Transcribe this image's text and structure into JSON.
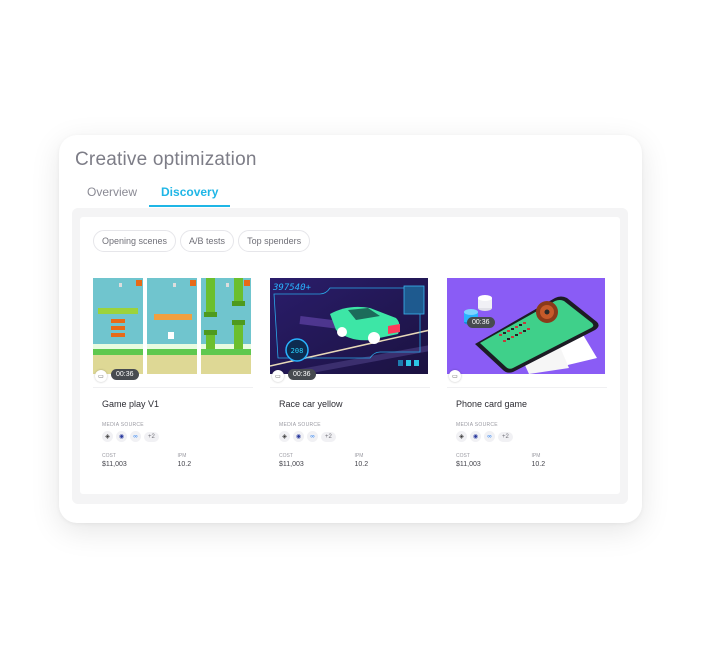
{
  "page": {
    "title": "Creative optimization",
    "tabs": [
      {
        "label": "Overview",
        "active": false
      },
      {
        "label": "Discovery",
        "active": true
      }
    ],
    "accent_color": "#1fb6e6"
  },
  "filters": [
    "Opening scenes",
    "A/B tests",
    "Top spenders"
  ],
  "media_source_label": "MEDIA SOURCE",
  "cost_label": "COST",
  "ipm_label": "IPM",
  "cards": [
    {
      "name": "Game play V1",
      "duration": "00:36",
      "thumbnail": "flappy-bird-gameplay",
      "media_sources": [
        "unity-icon",
        "ironsource-icon",
        "meta-icon"
      ],
      "media_more": "+2",
      "cost": "$11,003",
      "ipm": "10.2"
    },
    {
      "name": "Race car yellow",
      "duration": "00:36",
      "thumbnail": "race-car",
      "score_text": "397540+",
      "media_sources": [
        "unity-icon",
        "ironsource-icon",
        "meta-icon"
      ],
      "media_more": "+2",
      "cost": "$11,003",
      "ipm": "10.2"
    },
    {
      "name": "Phone card game",
      "duration": "00:36",
      "thumbnail": "roulette-phone-cards",
      "media_sources": [
        "unity-icon",
        "ironsource-icon",
        "meta-icon"
      ],
      "media_more": "+2",
      "cost": "$11,003",
      "ipm": "10.2"
    }
  ]
}
